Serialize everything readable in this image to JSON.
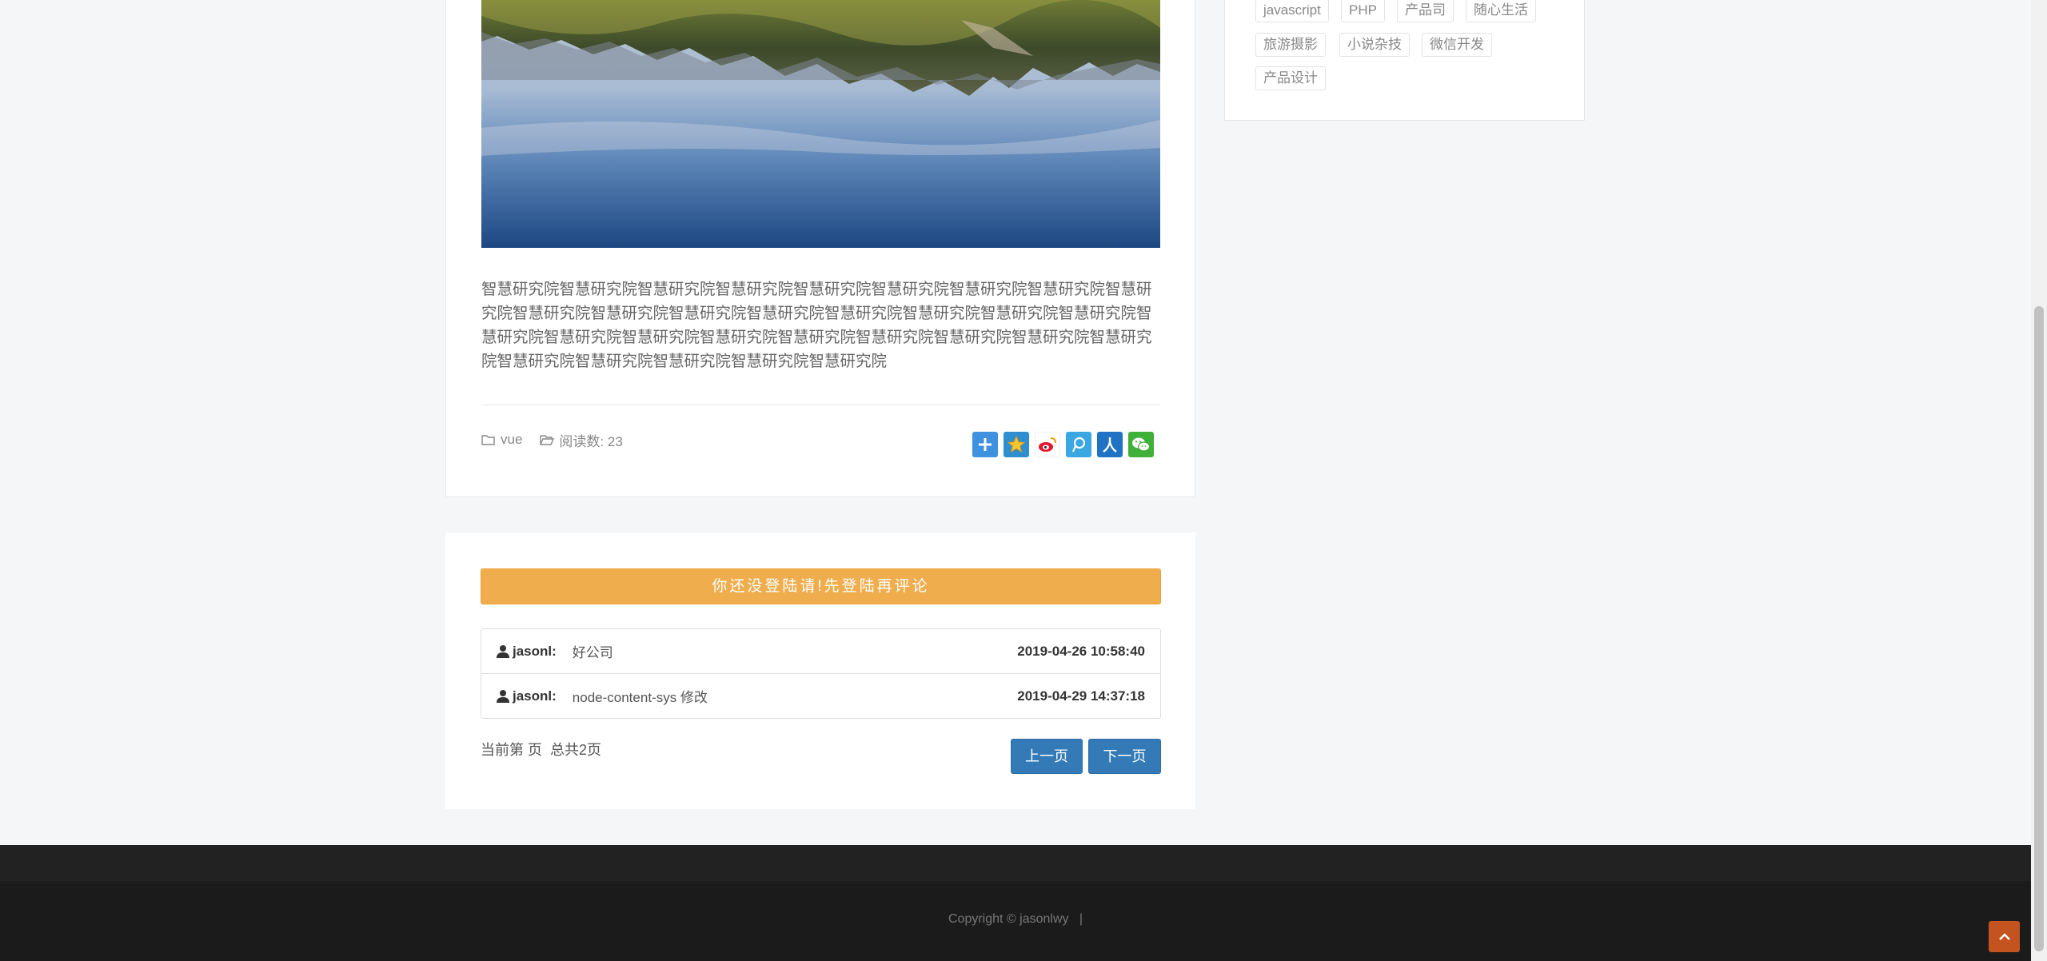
{
  "sidebar": {
    "tags": [
      "javascript",
      "PHP",
      "产品司",
      "随心生活",
      "旅游摄影",
      "小说杂技",
      "微信开发",
      "产品设计"
    ]
  },
  "article": {
    "body": "智慧研究院智慧研究院智慧研究院智慧研究院智慧研究院智慧研究院智慧研究院智慧研究院智慧研究院智慧研究院智慧研究院智慧研究院智慧研究院智慧研究院智慧研究院智慧研究院智慧研究院智慧研究院智慧研究院智慧研究院智慧研究院智慧研究院智慧研究院智慧研究院智慧研究院智慧研究院智慧研究院智慧研究院智慧研究院智慧研究院智慧研究院",
    "category": "vue",
    "read_count_label": "阅读数: 23",
    "share_icons": [
      "share-plus-icon",
      "qzone-icon",
      "weibo-icon",
      "tencent-weibo-icon",
      "renren-icon",
      "wechat-icon"
    ]
  },
  "comments": {
    "login_prompt": "你还没登陆请!先登陆再评论",
    "items": [
      {
        "user": "jasonl:",
        "text": "好公司",
        "time": "2019-04-26 10:58:40"
      },
      {
        "user": "jasonl:",
        "text": "node-content-sys 修改",
        "time": "2019-04-29 14:37:18"
      }
    ],
    "pager_info": "当前第 页  总共2页",
    "prev_label": "上一页",
    "next_label": "下一页"
  },
  "footer": {
    "copyright": "Copyright © jasonlwy   |"
  },
  "colors": {
    "warning": "#f0ad4e",
    "primary": "#337ab7",
    "back_to_top": "#c4541f"
  }
}
